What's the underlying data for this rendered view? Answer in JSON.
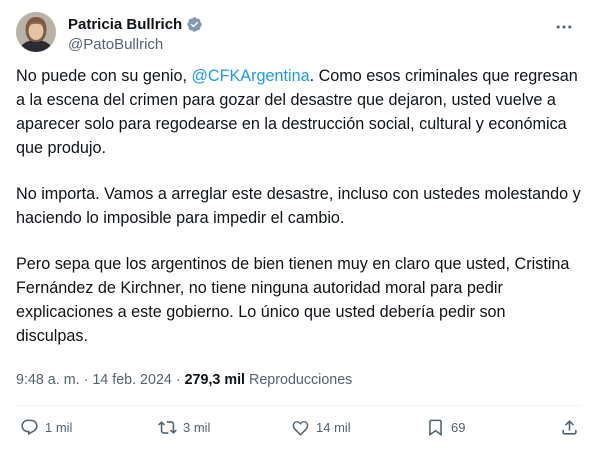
{
  "author": {
    "display_name": "Patricia Bullrich",
    "handle": "@PatoBullrich",
    "verified_icon": "verified-badge-icon"
  },
  "tweet": {
    "p1_before": "No puede con su genio, ",
    "p1_mention": "@CFKArgentina",
    "p1_after": ". Como esos criminales que regresan a la escena del crimen para gozar del desastre que dejaron, usted vuelve a aparecer solo para regodearse en la destrucción social, cultural y económica que produjo.",
    "p2": "No importa. Vamos a arreglar este desastre, incluso con ustedes molestando y haciendo lo imposible para impedir el cambio.",
    "p3": "Pero sepa que los argentinos de bien tienen muy en claro que usted, Cristina Fernández de Kirchner, no tiene ninguna autoridad moral para pedir explicaciones a este gobierno. Lo único que usted debería pedir son disculpas."
  },
  "meta": {
    "time": "9:48 a. m.",
    "separator": "·",
    "date": "14 feb. 2024",
    "views_count": "279,3 mil",
    "views_label": "Reproducciones"
  },
  "actions": {
    "reply_count": "1 mil",
    "retweet_count": "3 mil",
    "like_count": "14 mil",
    "bookmark_count": "69"
  },
  "colors": {
    "accent": "#1d9bf0",
    "secondary_text": "#536471",
    "verified_bg": "#829aab"
  }
}
